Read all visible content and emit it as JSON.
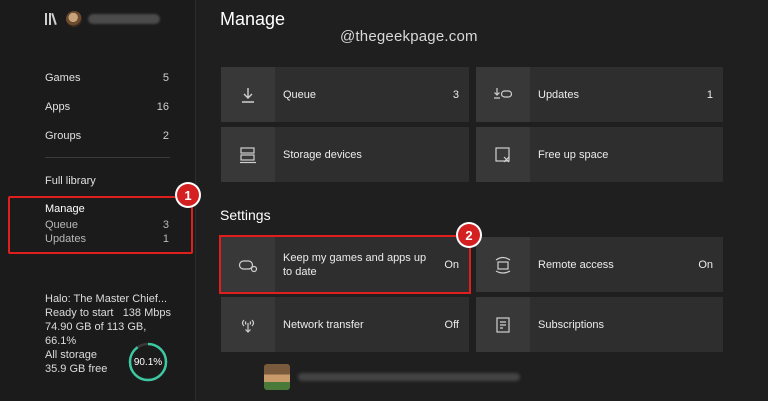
{
  "sidebar": {
    "nav": [
      {
        "label": "Games",
        "count": "5"
      },
      {
        "label": "Apps",
        "count": "16"
      },
      {
        "label": "Groups",
        "count": "2"
      }
    ],
    "full_library": "Full library",
    "manage": {
      "title": "Manage",
      "items": [
        {
          "label": "Queue",
          "count": "3"
        },
        {
          "label": "Updates",
          "count": "1"
        }
      ]
    },
    "game": {
      "name": "Halo: The Master Chief...",
      "status": "Ready to start",
      "speed": "138 Mbps",
      "size": "74.90 GB of 113 GB, 66.1%"
    },
    "storage": {
      "label": "All storage",
      "free": "35.9 GB free",
      "percent_label": "90.1%",
      "percent": 90.1
    }
  },
  "main": {
    "title": "Manage",
    "watermark": "@thegeekpage.com",
    "tiles": [
      {
        "label": "Queue",
        "value": "3",
        "icon": "download-icon"
      },
      {
        "label": "Updates",
        "value": "1",
        "icon": "controller-download-icon"
      },
      {
        "label": "Storage devices",
        "value": "",
        "icon": "storage-icon"
      },
      {
        "label": "Free up space",
        "value": "",
        "icon": "free-space-icon"
      }
    ],
    "settings_title": "Settings",
    "settings": [
      {
        "label": "Keep my games and apps up to date",
        "value": "On",
        "icon": "controller-settings-icon"
      },
      {
        "label": "Remote access",
        "value": "On",
        "icon": "remote-access-icon"
      },
      {
        "label": "Network transfer",
        "value": "Off",
        "icon": "network-transfer-icon"
      },
      {
        "label": "Subscriptions",
        "value": "",
        "icon": "subscriptions-icon"
      }
    ]
  },
  "annotations": {
    "step1": "1",
    "step2": "2"
  },
  "colors": {
    "highlight": "#e01e1e",
    "badge": "#d42020",
    "ring": "#3cc8a0"
  }
}
